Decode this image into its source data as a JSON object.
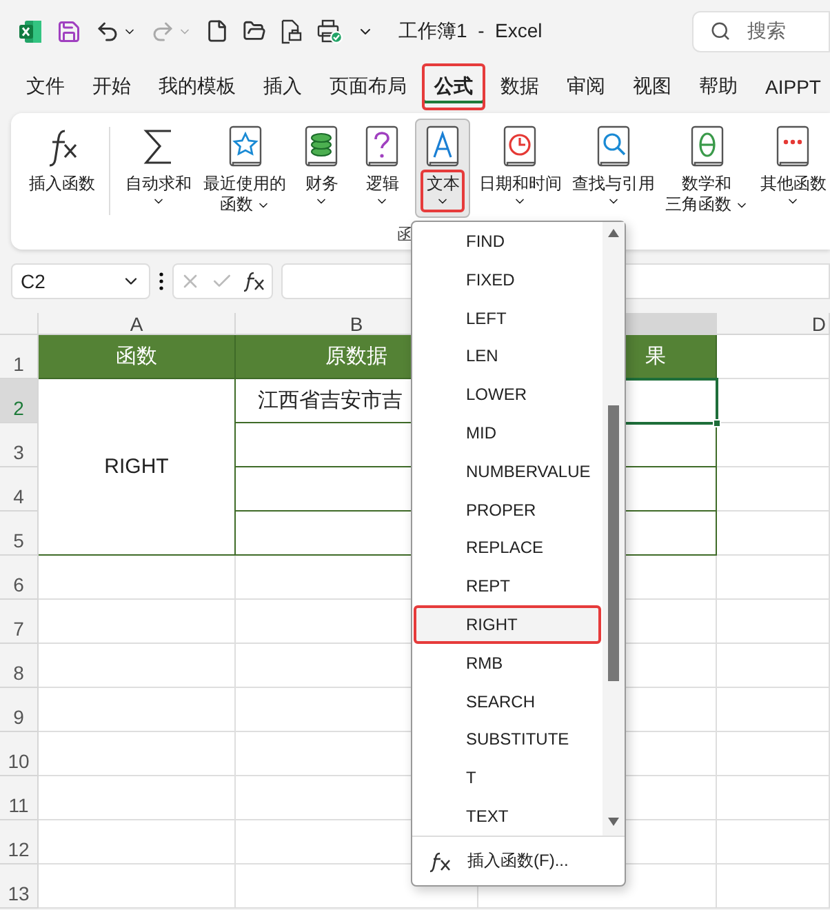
{
  "window": {
    "title": "工作簿1  -  Excel",
    "search_placeholder": "搜索"
  },
  "tabs": [
    {
      "label": "文件",
      "selected": false
    },
    {
      "label": "开始",
      "selected": false
    },
    {
      "label": "我的模板",
      "selected": false
    },
    {
      "label": "插入",
      "selected": false
    },
    {
      "label": "页面布局",
      "selected": false
    },
    {
      "label": "公式",
      "selected": true
    },
    {
      "label": "数据",
      "selected": false
    },
    {
      "label": "审阅",
      "selected": false
    },
    {
      "label": "视图",
      "selected": false
    },
    {
      "label": "帮助",
      "selected": false
    },
    {
      "label": "AIPPT",
      "selected": false
    }
  ],
  "ribbon": {
    "group_label": "函",
    "buttons": [
      {
        "kind": "fx",
        "lines": [
          "插入函数"
        ],
        "caret": false,
        "selected": false
      },
      {
        "kind": "sigma",
        "lines": [
          "自动求和"
        ],
        "caret": true,
        "selected": false
      },
      {
        "kind": "star",
        "lines": [
          "最近使用的",
          "函数"
        ],
        "caret": true,
        "selected": false
      },
      {
        "kind": "coins",
        "lines": [
          "财务"
        ],
        "caret": true,
        "selected": false
      },
      {
        "kind": "question",
        "lines": [
          "逻辑"
        ],
        "caret": true,
        "selected": false
      },
      {
        "kind": "letter",
        "lines": [
          "文本"
        ],
        "caret": true,
        "selected": true
      },
      {
        "kind": "clock",
        "lines": [
          "日期和时间"
        ],
        "caret": true,
        "selected": false
      },
      {
        "kind": "magnifier",
        "lines": [
          "查找与引用"
        ],
        "caret": true,
        "selected": false
      },
      {
        "kind": "theta",
        "lines": [
          "数学和",
          "三角函数"
        ],
        "caret": true,
        "selected": false
      },
      {
        "kind": "dots",
        "lines": [
          "其他函数"
        ],
        "caret": true,
        "selected": false
      }
    ]
  },
  "formula_bar": {
    "name_box": "C2"
  },
  "sheet": {
    "column_headers": {
      "a": "A",
      "b": "B",
      "d": "D"
    },
    "row_numbers": [
      "1",
      "2",
      "3",
      "4",
      "5",
      "6",
      "7",
      "8",
      "9",
      "10",
      "11",
      "12",
      "13"
    ],
    "header_row": [
      "函数",
      "原数据",
      "果"
    ],
    "function_cell": "RIGHT",
    "data_cell": "江西省吉安市吉",
    "result_cells": [
      {
        "selected": true
      },
      {
        "selected": false
      },
      {
        "selected": false
      },
      {
        "selected": false
      }
    ]
  },
  "dropdown": {
    "items": [
      {
        "label": "FIND",
        "selected": false
      },
      {
        "label": "FIXED",
        "selected": false
      },
      {
        "label": "LEFT",
        "selected": false
      },
      {
        "label": "LEN",
        "selected": false
      },
      {
        "label": "LOWER",
        "selected": false
      },
      {
        "label": "MID",
        "selected": false
      },
      {
        "label": "NUMBERVALUE",
        "selected": false
      },
      {
        "label": "PROPER",
        "selected": false
      },
      {
        "label": "REPLACE",
        "selected": false
      },
      {
        "label": "REPT",
        "selected": false
      },
      {
        "label": "RIGHT",
        "selected": true
      },
      {
        "label": "RMB",
        "selected": false
      },
      {
        "label": "SEARCH",
        "selected": false
      },
      {
        "label": "SUBSTITUTE",
        "selected": false
      },
      {
        "label": "T",
        "selected": false
      },
      {
        "label": "TEXT",
        "selected": false
      }
    ],
    "footer": "插入函数(F)..."
  }
}
